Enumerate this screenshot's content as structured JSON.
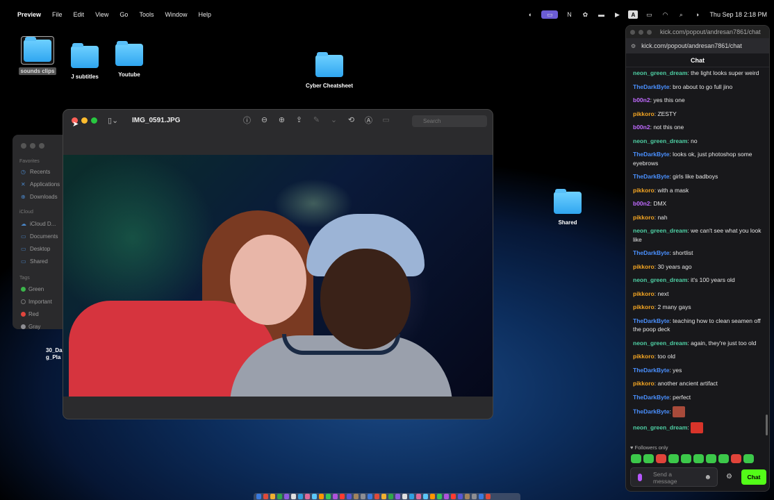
{
  "menubar": {
    "app": "Preview",
    "menus": [
      "File",
      "Edit",
      "View",
      "Go",
      "Tools",
      "Window",
      "Help"
    ],
    "clock": "Thu Sep 18  2:18 PM",
    "status_icons": [
      "screen-share-icon",
      "mirror-icon",
      "notion-icon",
      "chatgpt-icon",
      "game-icon",
      "play-icon",
      "text-icon",
      "battery-icon",
      "wifi-icon",
      "search-icon",
      "control-center-icon"
    ]
  },
  "desktop": {
    "icons": [
      {
        "name": "sounds clips"
      },
      {
        "name": "J subtitles"
      },
      {
        "name": "Youtube"
      },
      {
        "name": "Cyber Cheatsheet"
      },
      {
        "name": "Shared"
      }
    ],
    "stray_label": "30_Da g_Pla"
  },
  "finder": {
    "favorites_header": "Favorites",
    "favorites": [
      "Recents",
      "Applications",
      "Downloads"
    ],
    "icloud_header": "iCloud",
    "icloud": [
      "iCloud D...",
      "Documents",
      "Desktop",
      "Shared"
    ],
    "tags_header": "Tags",
    "tags": [
      {
        "label": "Green",
        "color": "#3bb54a"
      },
      {
        "label": "Important",
        "color": "#777777"
      },
      {
        "label": "Red",
        "color": "#e0453d"
      },
      {
        "label": "Gray",
        "color": "#8e8e93"
      }
    ]
  },
  "preview": {
    "title": "IMG_0591.JPG",
    "search_placeholder": "Search"
  },
  "chat": {
    "window_title": "kick.com/popout/andresan7861/chat",
    "url": "kick.com/popout/andresan7861/chat",
    "header": "Chat",
    "messages": [
      {
        "user": "neon_green_dream",
        "color": "#4fd1a5",
        "text": "the light looks super weird"
      },
      {
        "user": "TheDarkByte",
        "color": "#4a90ff",
        "text": "bro about to go full jino"
      },
      {
        "user": "b00n2",
        "color": "#c06bff",
        "text": "yes this one"
      },
      {
        "user": "pikkoro",
        "color": "#f5a623",
        "text": "ZESTY"
      },
      {
        "user": "b00n2",
        "color": "#c06bff",
        "text": "not this one"
      },
      {
        "user": "neon_green_dream",
        "color": "#4fd1a5",
        "text": "no"
      },
      {
        "user": "TheDarkByte",
        "color": "#4a90ff",
        "text": "looks ok, just photoshop some eyebrows"
      },
      {
        "user": "TheDarkByte",
        "color": "#4a90ff",
        "text": "girls like badboys"
      },
      {
        "user": "pikkoro",
        "color": "#f5a623",
        "text": "with a mask"
      },
      {
        "user": "b00n2",
        "color": "#c06bff",
        "text": "DMX"
      },
      {
        "user": "pikkoro",
        "color": "#f5a623",
        "text": "nah"
      },
      {
        "user": "neon_green_dream",
        "color": "#4fd1a5",
        "text": "we can't see what you look like"
      },
      {
        "user": "TheDarkByte",
        "color": "#4a90ff",
        "text": "shortlist"
      },
      {
        "user": "pikkoro",
        "color": "#f5a623",
        "text": "30 years ago"
      },
      {
        "user": "neon_green_dream",
        "color": "#4fd1a5",
        "text": "it's 100 years old"
      },
      {
        "user": "pikkoro",
        "color": "#f5a623",
        "text": "next"
      },
      {
        "user": "pikkoro",
        "color": "#f5a623",
        "text": "2 many gays"
      },
      {
        "user": "TheDarkByte",
        "color": "#4a90ff",
        "text": "teaching how to clean seamen off the poop deck"
      },
      {
        "user": "neon_green_dream",
        "color": "#4fd1a5",
        "text": "again, they're just too old"
      },
      {
        "user": "pikkoro",
        "color": "#f5a623",
        "text": "too old"
      },
      {
        "user": "TheDarkByte",
        "color": "#4a90ff",
        "text": "yes"
      },
      {
        "user": "pikkoro",
        "color": "#f5a623",
        "text": "another ancient artifact"
      },
      {
        "user": "TheDarkByte",
        "color": "#4a90ff",
        "text": "perfect"
      },
      {
        "user": "TheDarkByte",
        "color": "#4a90ff",
        "text": "",
        "emote": "#a84a3a"
      },
      {
        "user": "neon_green_dream",
        "color": "#4fd1a5",
        "text": "",
        "emote": "#d8342a"
      }
    ],
    "followers_only": "Followers only",
    "input_placeholder": "Send a message",
    "send_label": "Chat",
    "accent": "#53fc18"
  }
}
